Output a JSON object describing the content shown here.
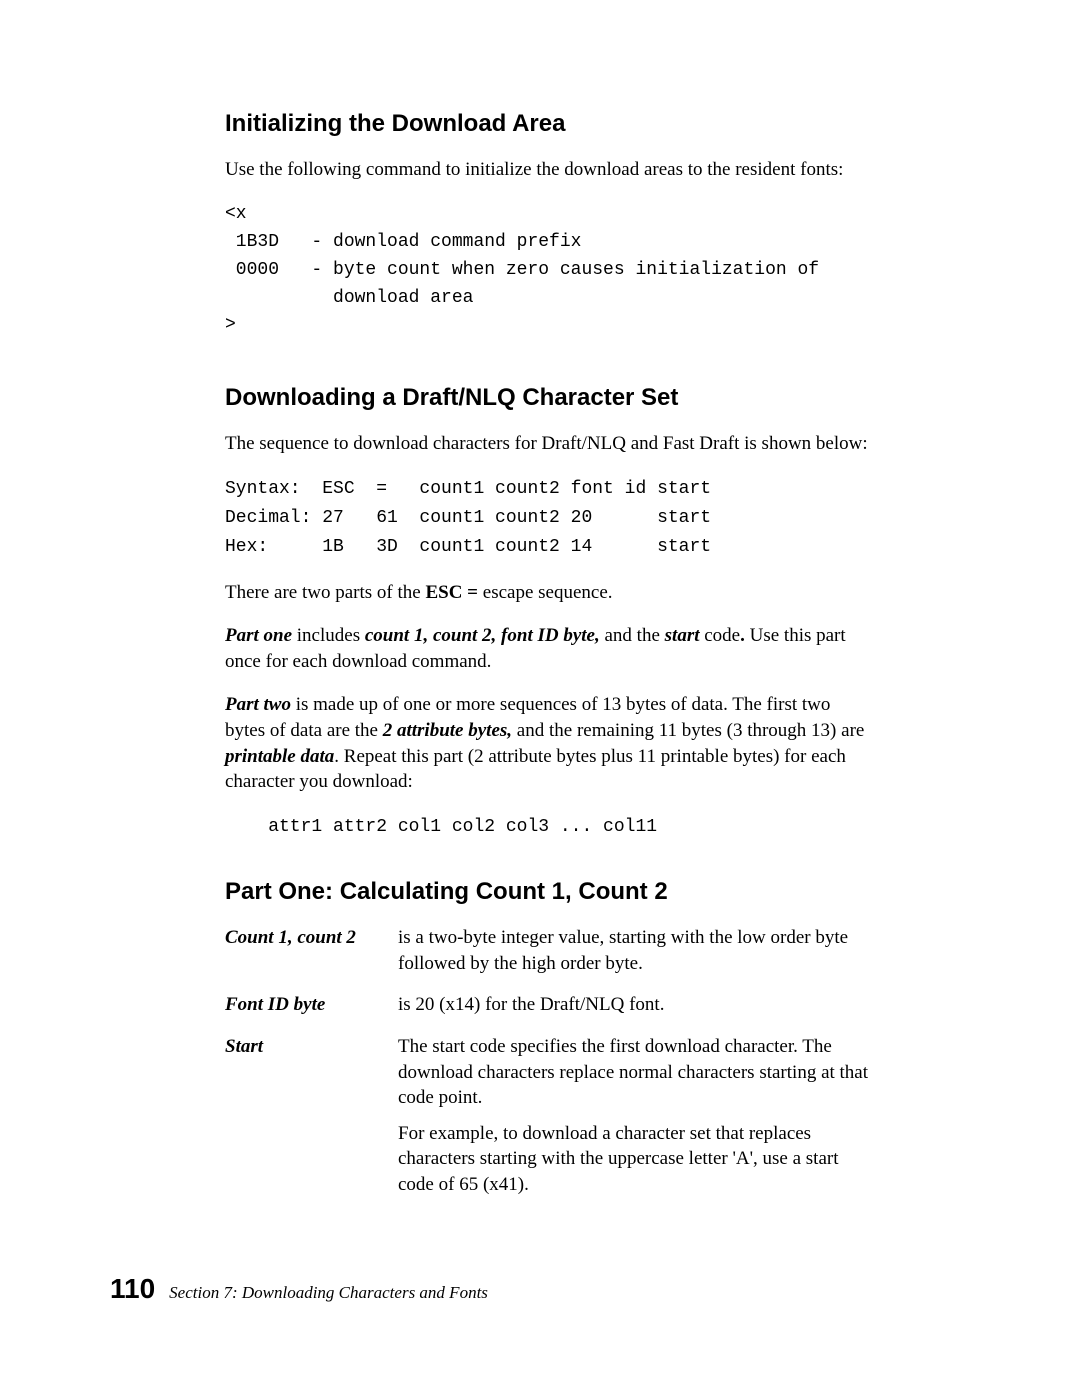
{
  "section1": {
    "heading": "Initializing the Download Area",
    "intro": "Use the following command to initialize the download areas to the resident fonts:",
    "code": "<x\n 1B3D   - download command prefix\n 0000   - byte count when zero causes initialization of\n          download area\n>"
  },
  "section2": {
    "heading": "Downloading a Draft/NLQ Character Set",
    "intro": "The sequence to download characters for Draft/NLQ and Fast Draft is shown below:",
    "code": "Syntax:  ESC  =   count1 count2 font id start\nDecimal: 27   61  count1 count2 20      start\nHex:     1B   3D  count1 count2 14      start",
    "para1_pre": "There are two parts of the ",
    "para1_bold": "ESC =",
    "para1_post": " escape sequence.",
    "para2_a": "Part one",
    "para2_b": " includes ",
    "para2_c": "count 1, count 2, font ID byte,",
    "para2_d": " and the ",
    "para2_e": "start",
    "para2_f": " code",
    "para2_g": ".",
    "para2_h": " Use this part once for each download command.",
    "para3_a": "Part two",
    "para3_b": " is made up of one or more sequences of 13 bytes of data. The first two bytes of data are the ",
    "para3_c": "2 attribute bytes,",
    "para3_d": " and the remaining 11 bytes (3 through 13) are ",
    "para3_e": "printable data",
    "para3_f": ". Repeat this part (2 attribute bytes plus 11 printable bytes) for each character you download:",
    "code2": "    attr1 attr2 col1 col2 col3 ... col11"
  },
  "section3": {
    "heading": "Part One: Calculating Count 1, Count 2",
    "defs": [
      {
        "term": "Count 1, count 2",
        "paras": [
          "is a two-byte integer value, starting with the low order byte followed by the high order byte."
        ]
      },
      {
        "term": "Font ID byte",
        "paras": [
          "is 20 (x14) for the Draft/NLQ font."
        ]
      },
      {
        "term": "Start",
        "paras": [
          "The start code specifies the first download character. The download characters replace normal characters starting at that code point.",
          "For example, to download a character set that replaces characters starting with the uppercase letter 'A', use a start code of 65 (x41)."
        ]
      }
    ]
  },
  "footer": {
    "page": "110",
    "text": "Section 7: Downloading Characters and Fonts"
  }
}
